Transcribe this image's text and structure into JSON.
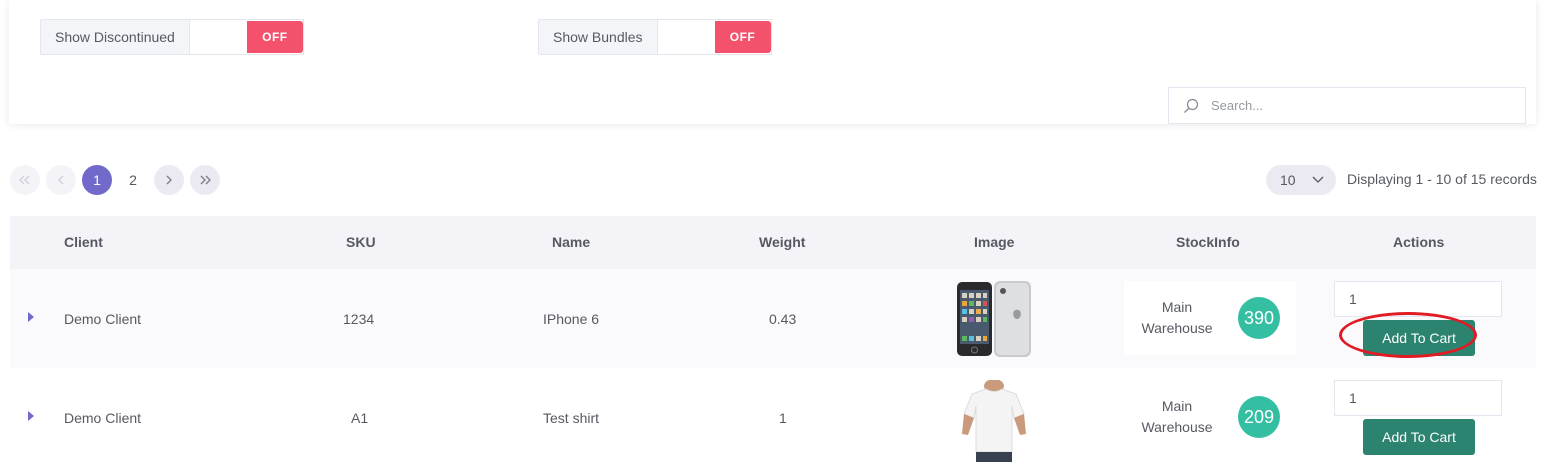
{
  "filters": {
    "discontinued": {
      "label": "Show Discontinued",
      "state": "OFF"
    },
    "bundles": {
      "label": "Show Bundles",
      "state": "OFF"
    },
    "search_placeholder": "Search..."
  },
  "pagination": {
    "pages": [
      "1",
      "2"
    ],
    "per_page": "10",
    "records_text": "Displaying 1 - 10 of 15 records"
  },
  "table": {
    "headers": {
      "client": "Client",
      "sku": "SKU",
      "name": "Name",
      "weight": "Weight",
      "image": "Image",
      "stockinfo": "StockInfo",
      "actions": "Actions"
    },
    "rows": [
      {
        "client": "Demo Client",
        "sku": "1234",
        "name": "IPhone 6",
        "weight": "0.43",
        "image": "iphone-image",
        "warehouse_line1": "Main",
        "warehouse_line2": "Warehouse",
        "stock_qty": "390",
        "quantity": "1",
        "cart_label": "Add To Cart"
      },
      {
        "client": "Demo Client",
        "sku": "A1",
        "name": "Test shirt",
        "weight": "1",
        "image": "tshirt-image",
        "warehouse_line1": "Main",
        "warehouse_line2": "Warehouse",
        "stock_qty": "209",
        "quantity": "1",
        "cart_label": "Add To Cart"
      }
    ]
  },
  "colors": {
    "accent": "#716aca",
    "toggle_off": "#f4516c",
    "stock_badge": "#34bfa3",
    "cart_button": "#2c8470",
    "highlight": "#e01b24"
  }
}
